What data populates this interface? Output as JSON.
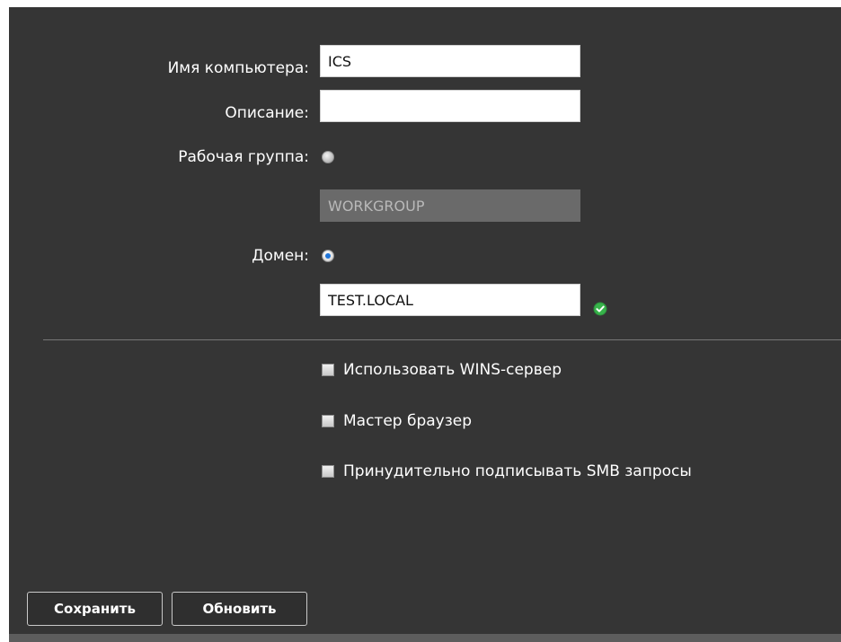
{
  "form": {
    "computer_name": {
      "label": "Имя компьютера:",
      "value": "ICS"
    },
    "description": {
      "label": "Описание:",
      "value": ""
    },
    "workgroup": {
      "label": "Рабочая группа:",
      "selected": false,
      "value": "WORKGROUP",
      "disabled": true
    },
    "domain": {
      "label": "Домен:",
      "selected": true,
      "value": "TEST.LOCAL",
      "status_icon": "check-circle-icon"
    },
    "checkboxes": [
      {
        "label": "Использовать WINS-сервер",
        "checked": false
      },
      {
        "label": "Мастер браузер",
        "checked": false
      },
      {
        "label": "Принудительно подписывать SMB запросы",
        "checked": false
      }
    ]
  },
  "buttons": {
    "save": "Сохранить",
    "refresh": "Обновить"
  },
  "colors": {
    "panel_background": "#353535",
    "text": "#ffffff",
    "input_background": "#ffffff",
    "disabled_input_background": "#6a6a6a",
    "radio_selected": "#1e74d8",
    "success": "#37b34a"
  }
}
